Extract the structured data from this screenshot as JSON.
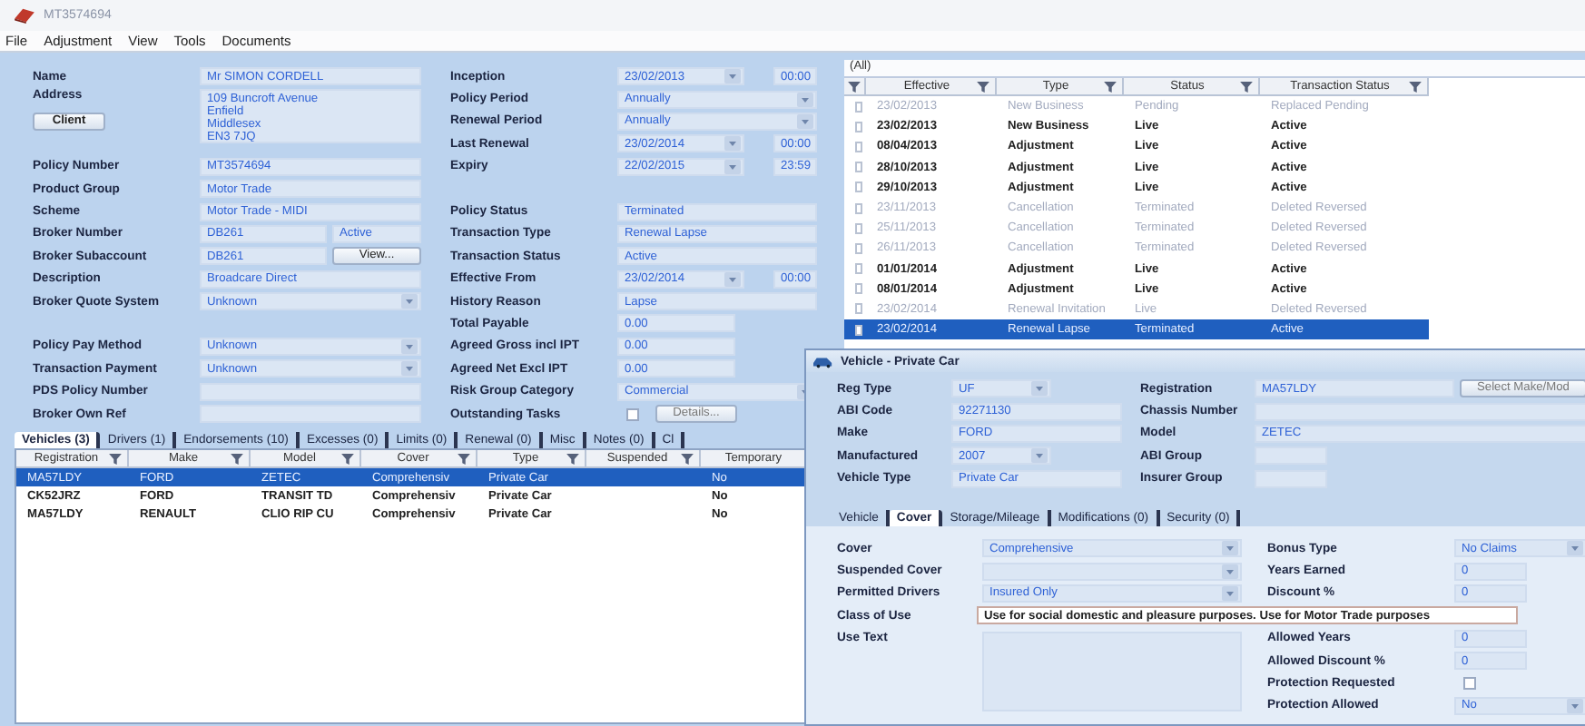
{
  "window": {
    "title": "MT3574694"
  },
  "menu": [
    "File",
    "Adjustment",
    "View",
    "Tools",
    "Documents"
  ],
  "policy": {
    "left": [
      {
        "label": "Name",
        "kind": "text",
        "value": "Mr SIMON CORDELL"
      },
      {
        "label": "Address",
        "kind": "address",
        "lines": [
          "109 Buncroft Avenue",
          "Enfield",
          "Middlesex",
          "EN3 7JQ"
        ],
        "button": "Client"
      },
      {
        "label": "Policy Number",
        "kind": "text",
        "value": "MT3574694"
      },
      {
        "label": "Product Group",
        "kind": "text",
        "value": "Motor Trade"
      },
      {
        "label": "Scheme",
        "kind": "text",
        "value": "Motor Trade - MIDI"
      },
      {
        "label": "Broker Number",
        "kind": "split",
        "value": "DB261",
        "extra": "Active"
      },
      {
        "label": "Broker Subaccount",
        "kind": "split",
        "value": "DB261",
        "extra_button": "View..."
      },
      {
        "label": "Description",
        "kind": "text",
        "value": "Broadcare Direct"
      },
      {
        "label": "Broker Quote System",
        "kind": "combo",
        "value": "Unknown"
      },
      {
        "label": "Policy Pay Method",
        "kind": "combo",
        "value": "Unknown",
        "gap_before": true
      },
      {
        "label": "Transaction Payment",
        "kind": "combo",
        "value": "Unknown"
      },
      {
        "label": "PDS Policy Number",
        "kind": "text"
      },
      {
        "label": "Broker Own Ref",
        "kind": "text"
      }
    ],
    "right": [
      {
        "label": "Inception",
        "kind": "date",
        "date": "23/02/2013",
        "time": "00:00"
      },
      {
        "label": "Policy Period",
        "kind": "combo",
        "value": "Annually"
      },
      {
        "label": "Renewal Period",
        "kind": "combo",
        "value": "Annually"
      },
      {
        "label": "Last Renewal",
        "kind": "date",
        "date": "23/02/2014",
        "time": "00:00"
      },
      {
        "label": "Expiry",
        "kind": "date",
        "date": "22/02/2015",
        "time": "23:59"
      },
      {
        "label": "Policy Status",
        "kind": "text",
        "value": "Terminated",
        "gap_before": true
      },
      {
        "label": "Transaction Type",
        "kind": "text",
        "value": "Renewal Lapse"
      },
      {
        "label": "Transaction Status",
        "kind": "text",
        "value": "Active"
      },
      {
        "label": "Effective From",
        "kind": "date",
        "date": "23/02/2014",
        "time": "00:00"
      },
      {
        "label": "History Reason",
        "kind": "text",
        "value": "Lapse"
      },
      {
        "label": "Total Payable",
        "kind": "short",
        "value": "0.00"
      },
      {
        "label": "Agreed Gross incl IPT",
        "kind": "short",
        "value": "0.00"
      },
      {
        "label": "Agreed Net Excl IPT",
        "kind": "short",
        "value": "0.00"
      },
      {
        "label": "Risk Group Category",
        "kind": "combo",
        "value": "Commercial"
      },
      {
        "label": "Outstanding Tasks",
        "kind": "tasks",
        "checked": false,
        "button": "Details..."
      }
    ]
  },
  "transactions": {
    "filter": "(All)",
    "columns": [
      "Effective",
      "Type",
      "Status",
      "Transaction Status"
    ],
    "rows": [
      {
        "checked": false,
        "active": false,
        "selected": false,
        "cells": [
          "23/02/2013",
          "New Business",
          "Pending",
          "Replaced Pending"
        ]
      },
      {
        "checked": false,
        "active": true,
        "selected": false,
        "cells": [
          "23/02/2013",
          "New Business",
          "Live",
          "Active"
        ]
      },
      {
        "checked": false,
        "active": true,
        "selected": false,
        "cells": [
          "08/04/2013",
          "Adjustment",
          "Live",
          "Active"
        ]
      },
      {
        "checked": false,
        "active": true,
        "selected": false,
        "cells": [
          "28/10/2013",
          "Adjustment",
          "Live",
          "Active"
        ]
      },
      {
        "checked": false,
        "active": true,
        "selected": false,
        "cells": [
          "29/10/2013",
          "Adjustment",
          "Live",
          "Active"
        ]
      },
      {
        "checked": false,
        "active": false,
        "selected": false,
        "cells": [
          "23/11/2013",
          "Cancellation",
          "Terminated",
          "Deleted Reversed"
        ]
      },
      {
        "checked": false,
        "active": false,
        "selected": false,
        "cells": [
          "25/11/2013",
          "Cancellation",
          "Terminated",
          "Deleted Reversed"
        ]
      },
      {
        "checked": false,
        "active": false,
        "selected": false,
        "cells": [
          "26/11/2013",
          "Cancellation",
          "Terminated",
          "Deleted Reversed"
        ]
      },
      {
        "checked": false,
        "active": true,
        "selected": false,
        "cells": [
          "01/01/2014",
          "Adjustment",
          "Live",
          "Active"
        ]
      },
      {
        "checked": false,
        "active": true,
        "selected": false,
        "cells": [
          "08/01/2014",
          "Adjustment",
          "Live",
          "Active"
        ]
      },
      {
        "checked": false,
        "active": false,
        "selected": false,
        "cells": [
          "23/02/2014",
          "Renewal Invitation",
          "Live",
          "Deleted Reversed"
        ]
      },
      {
        "checked": false,
        "active": true,
        "selected": true,
        "cells": [
          "23/02/2014",
          "Renewal Lapse",
          "Terminated",
          "Active"
        ]
      }
    ]
  },
  "tabs": [
    {
      "label": "Vehicles (3)",
      "selected": true
    },
    {
      "label": "Drivers (1)",
      "selected": false
    },
    {
      "label": "Endorsements (10)",
      "selected": false
    },
    {
      "label": "Excesses (0)",
      "selected": false
    },
    {
      "label": "Limits (0)",
      "selected": false
    },
    {
      "label": "Renewal (0)",
      "selected": false
    },
    {
      "label": "Misc",
      "selected": false
    },
    {
      "label": "Notes (0)",
      "selected": false
    },
    {
      "label": "Cl",
      "selected": false
    }
  ],
  "vehicles": {
    "columns": [
      "Registration",
      "Make",
      "Model",
      "Cover",
      "Type",
      "Suspended",
      "Temporary"
    ],
    "rows": [
      {
        "selected": true,
        "cells": [
          "MA57LDY",
          "FORD",
          "ZETEC",
          "Comprehensiv",
          "Private Car",
          "",
          "No"
        ]
      },
      {
        "selected": false,
        "cells": [
          "CK52JRZ",
          "FORD",
          "TRANSIT TD",
          "Comprehensiv",
          "Private Car",
          "",
          "No"
        ]
      },
      {
        "selected": false,
        "cells": [
          "MA57LDY",
          "RENAULT",
          "CLIO RIP CU",
          "Comprehensiv",
          "Private Car",
          "",
          "No"
        ]
      }
    ]
  },
  "dialog": {
    "title": "Vehicle - Private Car",
    "left": [
      {
        "label": "Reg Type",
        "kind": "combo",
        "value": "UF"
      },
      {
        "label": "ABI Code",
        "kind": "text",
        "value": "92271130"
      },
      {
        "label": "Make",
        "kind": "text",
        "value": "FORD"
      },
      {
        "label": "Manufactured",
        "kind": "combo",
        "value": "2007"
      },
      {
        "label": "Vehicle Type",
        "kind": "text",
        "value": "Private Car"
      }
    ],
    "right": [
      {
        "label": "Registration",
        "kind": "text",
        "value": "MA57LDY",
        "button": "Select Make/Mod"
      },
      {
        "label": "Chassis Number",
        "kind": "text"
      },
      {
        "label": "Model",
        "kind": "text",
        "value": "ZETEC"
      },
      {
        "label": "ABI Group",
        "kind": "short"
      },
      {
        "label": "Insurer Group",
        "kind": "short"
      }
    ],
    "tabs": [
      {
        "label": "Vehicle",
        "selected": false
      },
      {
        "label": "Cover",
        "selected": true
      },
      {
        "label": "Storage/Mileage",
        "selected": false
      },
      {
        "label": "Modifications (0)",
        "selected": false
      },
      {
        "label": "Security (0)",
        "selected": false
      }
    ],
    "cover": {
      "left": [
        {
          "label": "Cover",
          "kind": "combo",
          "value": "Comprehensive"
        },
        {
          "label": "Suspended Cover",
          "kind": "combo"
        },
        {
          "label": "Permitted Drivers",
          "kind": "combo",
          "value": "Insured Only"
        }
      ],
      "right": [
        {
          "label": "Bonus Type",
          "kind": "combo",
          "value": "No Claims"
        },
        {
          "label": "Years Earned",
          "kind": "short",
          "value": "0"
        },
        {
          "label": "Discount %",
          "kind": "short",
          "value": "0"
        }
      ],
      "class_of_use": {
        "label": "Class of Use",
        "value": "Use for social domestic and pleasure purposes. Use for Motor Trade purposes"
      },
      "use_text": {
        "label": "Use Text"
      },
      "right_lower": [
        {
          "label": "Allowed Years",
          "kind": "short",
          "value": "0"
        },
        {
          "label": "Allowed Discount %",
          "kind": "short",
          "value": "0"
        },
        {
          "label": "Protection Requested",
          "kind": "check",
          "checked": false
        },
        {
          "label": "Protection Allowed",
          "kind": "combo",
          "value": "No"
        }
      ]
    }
  }
}
